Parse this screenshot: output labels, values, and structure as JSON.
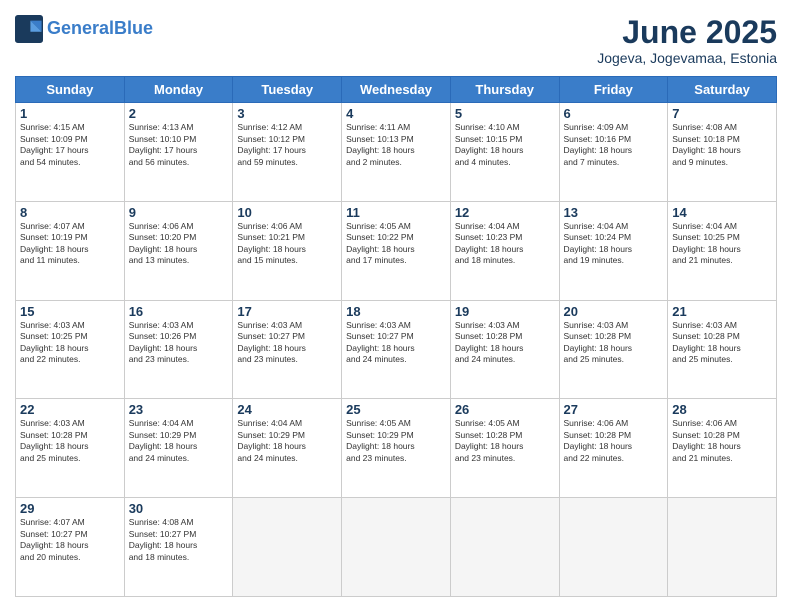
{
  "header": {
    "logo_line1": "General",
    "logo_line2": "Blue",
    "month": "June 2025",
    "location": "Jogeva, Jogevamaa, Estonia"
  },
  "weekdays": [
    "Sunday",
    "Monday",
    "Tuesday",
    "Wednesday",
    "Thursday",
    "Friday",
    "Saturday"
  ],
  "weeks": [
    [
      {
        "day": "1",
        "info": "Sunrise: 4:15 AM\nSunset: 10:09 PM\nDaylight: 17 hours\nand 54 minutes."
      },
      {
        "day": "2",
        "info": "Sunrise: 4:13 AM\nSunset: 10:10 PM\nDaylight: 17 hours\nand 56 minutes."
      },
      {
        "day": "3",
        "info": "Sunrise: 4:12 AM\nSunset: 10:12 PM\nDaylight: 17 hours\nand 59 minutes."
      },
      {
        "day": "4",
        "info": "Sunrise: 4:11 AM\nSunset: 10:13 PM\nDaylight: 18 hours\nand 2 minutes."
      },
      {
        "day": "5",
        "info": "Sunrise: 4:10 AM\nSunset: 10:15 PM\nDaylight: 18 hours\nand 4 minutes."
      },
      {
        "day": "6",
        "info": "Sunrise: 4:09 AM\nSunset: 10:16 PM\nDaylight: 18 hours\nand 7 minutes."
      },
      {
        "day": "7",
        "info": "Sunrise: 4:08 AM\nSunset: 10:18 PM\nDaylight: 18 hours\nand 9 minutes."
      }
    ],
    [
      {
        "day": "8",
        "info": "Sunrise: 4:07 AM\nSunset: 10:19 PM\nDaylight: 18 hours\nand 11 minutes."
      },
      {
        "day": "9",
        "info": "Sunrise: 4:06 AM\nSunset: 10:20 PM\nDaylight: 18 hours\nand 13 minutes."
      },
      {
        "day": "10",
        "info": "Sunrise: 4:06 AM\nSunset: 10:21 PM\nDaylight: 18 hours\nand 15 minutes."
      },
      {
        "day": "11",
        "info": "Sunrise: 4:05 AM\nSunset: 10:22 PM\nDaylight: 18 hours\nand 17 minutes."
      },
      {
        "day": "12",
        "info": "Sunrise: 4:04 AM\nSunset: 10:23 PM\nDaylight: 18 hours\nand 18 minutes."
      },
      {
        "day": "13",
        "info": "Sunrise: 4:04 AM\nSunset: 10:24 PM\nDaylight: 18 hours\nand 19 minutes."
      },
      {
        "day": "14",
        "info": "Sunrise: 4:04 AM\nSunset: 10:25 PM\nDaylight: 18 hours\nand 21 minutes."
      }
    ],
    [
      {
        "day": "15",
        "info": "Sunrise: 4:03 AM\nSunset: 10:25 PM\nDaylight: 18 hours\nand 22 minutes."
      },
      {
        "day": "16",
        "info": "Sunrise: 4:03 AM\nSunset: 10:26 PM\nDaylight: 18 hours\nand 23 minutes."
      },
      {
        "day": "17",
        "info": "Sunrise: 4:03 AM\nSunset: 10:27 PM\nDaylight: 18 hours\nand 23 minutes."
      },
      {
        "day": "18",
        "info": "Sunrise: 4:03 AM\nSunset: 10:27 PM\nDaylight: 18 hours\nand 24 minutes."
      },
      {
        "day": "19",
        "info": "Sunrise: 4:03 AM\nSunset: 10:28 PM\nDaylight: 18 hours\nand 24 minutes."
      },
      {
        "day": "20",
        "info": "Sunrise: 4:03 AM\nSunset: 10:28 PM\nDaylight: 18 hours\nand 25 minutes."
      },
      {
        "day": "21",
        "info": "Sunrise: 4:03 AM\nSunset: 10:28 PM\nDaylight: 18 hours\nand 25 minutes."
      }
    ],
    [
      {
        "day": "22",
        "info": "Sunrise: 4:03 AM\nSunset: 10:28 PM\nDaylight: 18 hours\nand 25 minutes."
      },
      {
        "day": "23",
        "info": "Sunrise: 4:04 AM\nSunset: 10:29 PM\nDaylight: 18 hours\nand 24 minutes."
      },
      {
        "day": "24",
        "info": "Sunrise: 4:04 AM\nSunset: 10:29 PM\nDaylight: 18 hours\nand 24 minutes."
      },
      {
        "day": "25",
        "info": "Sunrise: 4:05 AM\nSunset: 10:29 PM\nDaylight: 18 hours\nand 23 minutes."
      },
      {
        "day": "26",
        "info": "Sunrise: 4:05 AM\nSunset: 10:28 PM\nDaylight: 18 hours\nand 23 minutes."
      },
      {
        "day": "27",
        "info": "Sunrise: 4:06 AM\nSunset: 10:28 PM\nDaylight: 18 hours\nand 22 minutes."
      },
      {
        "day": "28",
        "info": "Sunrise: 4:06 AM\nSunset: 10:28 PM\nDaylight: 18 hours\nand 21 minutes."
      }
    ],
    [
      {
        "day": "29",
        "info": "Sunrise: 4:07 AM\nSunset: 10:27 PM\nDaylight: 18 hours\nand 20 minutes."
      },
      {
        "day": "30",
        "info": "Sunrise: 4:08 AM\nSunset: 10:27 PM\nDaylight: 18 hours\nand 18 minutes."
      },
      {
        "day": "",
        "info": ""
      },
      {
        "day": "",
        "info": ""
      },
      {
        "day": "",
        "info": ""
      },
      {
        "day": "",
        "info": ""
      },
      {
        "day": "",
        "info": ""
      }
    ]
  ]
}
